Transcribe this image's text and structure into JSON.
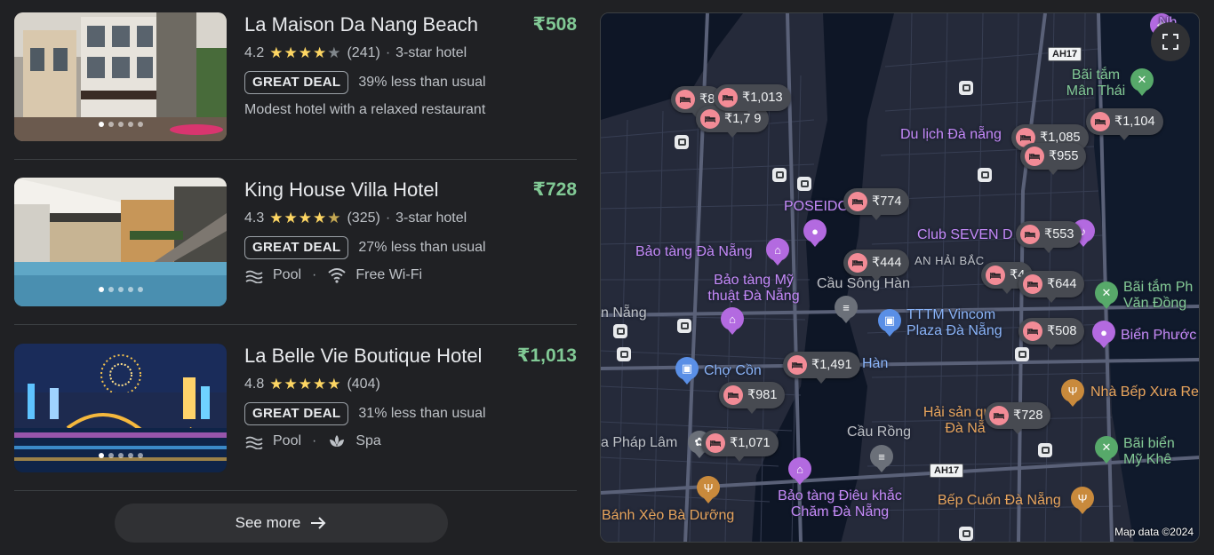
{
  "hotels": [
    {
      "name": "La Maison Da Nang Beach",
      "price": "₹508",
      "rating": "4.2",
      "stars_full": 4,
      "reviews": "(241)",
      "class": "3-star hotel",
      "deal_badge": "GREAT DEAL",
      "deal_text": "39% less than usual",
      "description": "Modest hotel with a relaxed restaurant",
      "image_dots": 5
    },
    {
      "name": "King House Villa Hotel",
      "price": "₹728",
      "rating": "4.3",
      "stars_full": 4,
      "reviews": "(325)",
      "class": "3-star hotel",
      "deal_badge": "GREAT DEAL",
      "deal_text": "27% less than usual",
      "amenities": [
        "Pool",
        "Free Wi-Fi"
      ],
      "amenity_icons": [
        "pool-icon",
        "wifi-icon"
      ],
      "image_dots": 5
    },
    {
      "name": "La Belle Vie Boutique Hotel",
      "price": "₹1,013",
      "rating": "4.8",
      "stars_full": 5,
      "reviews": "(404)",
      "deal_badge": "GREAT DEAL",
      "deal_text": "31% less than usual",
      "amenities": [
        "Pool",
        "Spa"
      ],
      "amenity_icons": [
        "pool-icon",
        "spa-icon"
      ],
      "image_dots": 5
    }
  ],
  "separator": "·",
  "see_more": "See more",
  "map": {
    "price_pins": [
      "₹8",
      "₹1,013",
      "₹1,7 9",
      "₹1,104",
      "₹1,085",
      "₹955",
      "₹774",
      "₹553",
      "₹444",
      "₹4",
      "₹644",
      "₹508",
      "₹1,491",
      "₹981",
      "₹728",
      "₹1,071"
    ],
    "labels": {
      "du_lich": "Du lịch Đà nẵng",
      "poseidon": "POSEIDO",
      "bao_tang_dn": "Bảo tàng Đà Nẵng",
      "bao_tang_my_thuat": "Bảo tàng Mỹ thuật Đà Nẵng",
      "club_seven": "Club SEVEN D",
      "an_hai_bac": "AN HẢI BẮC",
      "cau_song_han": "Cầu Sông Hàn",
      "vincom": "TTTM Vincom Plaza Đà Nẵng",
      "bai_tam_man_thai": "Bãi tắm Mân Thái",
      "bai_tam_pham_van_dong": "Bãi tắm Ph Văn Đồng",
      "bien_phuoc": "Biển Phước",
      "da_nang_left": "n Nẵng",
      "cho_con": "Chợ Cồn",
      "han": "Hàn",
      "nha_bep": "Nhà Bếp Xưa Re",
      "hai_san": "Hải sản quán Đà Nẵ",
      "cau_rong": "Cầu Rồng",
      "phap_lam": "a Pháp Lâm",
      "bai_bien_my_khe": "Bãi biển Mỹ Khê",
      "bao_tang_dieu_khac": "Bảo tàng Điêu khắc Chăm Đà Nẵng",
      "banh_xeo": "Bánh Xèo Bà Dưỡng",
      "bep_cuon": "Bếp Cuốn Đà Nẵng",
      "nh_top": "Nh"
    },
    "road_shields": [
      "AH17",
      "AH17"
    ],
    "credit": "Map data ©2024",
    "expand_icon": "expand-icon"
  },
  "colors": {
    "price_green": "#81c995",
    "star_yellow": "#fdd663",
    "hotel_pin": "#f28b96",
    "map_bg": "#1c2030"
  }
}
